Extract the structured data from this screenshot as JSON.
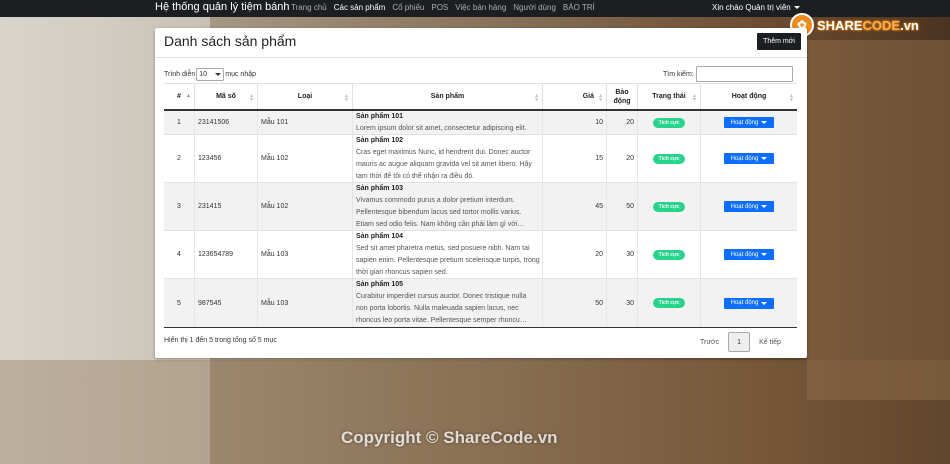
{
  "navbar": {
    "brand": "Hệ thống quản lý tiệm bánh",
    "items": [
      {
        "label": "Trang chủ",
        "active": false
      },
      {
        "label": "Các sản phẩm",
        "active": true
      },
      {
        "label": "Cổ phiếu",
        "active": false
      },
      {
        "label": "POS",
        "active": false
      },
      {
        "label": "Việc bán hàng",
        "active": false
      },
      {
        "label": "Người dùng",
        "active": false
      },
      {
        "label": "BÁO TRÍ",
        "active": false
      }
    ],
    "user_greeting": "Xin chào Quản trị viên"
  },
  "logo": {
    "text_a": "SHARE",
    "text_b": "CODE",
    "suffix": ".vn",
    "brand_color": "#f08a1c"
  },
  "watermark": "ShareCode.vn",
  "copyright": "Copyright © ShareCode.vn",
  "card": {
    "title": "Danh sách sản phẩm",
    "add_label": "Thêm mới",
    "length_prefix": "Trình diễn",
    "length_value": "10",
    "length_suffix": "mục nhập",
    "search_label": "Tìm kiếm:",
    "search_value": ""
  },
  "table": {
    "headers": [
      "#",
      "Mã số",
      "Loại",
      "Sản phẩm",
      "Giá",
      "Bảo động",
      "Trạng thái",
      "Hoạt động"
    ],
    "rows": [
      {
        "no": "1",
        "code": "23141506",
        "type": "Mẫu 101",
        "name": "Sản phẩm 101",
        "desc": "Lorem ipsum dolor sit amet, consectetur adipiscing elit.",
        "price": "10",
        "stock": "20",
        "status": "Tích cực",
        "action": "Hoạt động"
      },
      {
        "no": "2",
        "code": "123456",
        "type": "Mẫu 102",
        "name": "Sản phẩm 102",
        "desc": "Cras eget maximus Nunc, id hendrerit dui. Donec auctor mauris ac augue aliquam gravida vel sit amet libero. Hãy tạm thời để tôi có thể nhận ra điều đó.",
        "price": "15",
        "stock": "20",
        "status": "Tích cực",
        "action": "Hoạt động"
      },
      {
        "no": "3",
        "code": "231415",
        "type": "Mẫu 102",
        "name": "Sản phẩm 103",
        "desc": "Vivamus commodo purus a dolor pretium interdum. Pellentesque bibendum lacus sed tortor mollis varius. Etiam sed odio felis. Nam không cần phải làm gì với…",
        "price": "45",
        "stock": "50",
        "status": "Tích cực",
        "action": "Hoạt động"
      },
      {
        "no": "4",
        "code": "123654789",
        "type": "Mẫu 103",
        "name": "Sản phẩm 104",
        "desc": "Sed sit amet pharetra metus, sed posuere nibh. Nam tai sapien enim. Pellentesque pretium scelerisque turpis, trong thời gian rhoncus sapien sed.",
        "price": "20",
        "stock": "30",
        "status": "Tích cực",
        "action": "Hoạt động"
      },
      {
        "no": "5",
        "code": "987545",
        "type": "Mẫu 103",
        "name": "Sản phẩm 105",
        "desc": "Curabitur imperdiet cursus auctor. Donec tristique nulla non porta lobortis. Nulla maleuada sapien lacus, nec rhoncus leo porta vitae. Pellentesque semper rhoncu…",
        "price": "50",
        "stock": "30",
        "status": "Tích cực",
        "action": "Hoạt động"
      }
    ]
  },
  "footer": {
    "info": "Hiển thị 1 đến 5 trong tổng số 5 mục",
    "prev": "Trước",
    "page": "1",
    "next": "Kế tiếp"
  },
  "colors": {
    "status_badge": "#28d48c",
    "action_button": "#0d6efd",
    "navbar": "#1c1f22"
  }
}
